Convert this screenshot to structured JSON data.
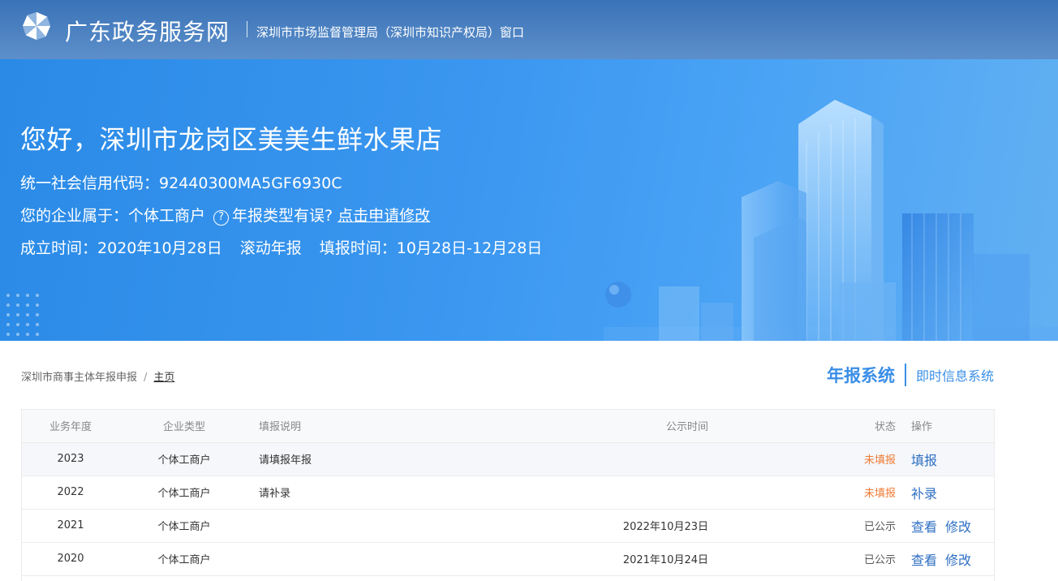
{
  "header": {
    "site_name": "广东政务服务网",
    "window_name": "深圳市市场监督管理局（深圳市知识产权局）窗口",
    "logo_icon": "pinwheel-logo"
  },
  "hero": {
    "greeting": "您好，深圳市龙岗区美美生鲜水果店",
    "credit_code_label": "统一社会信用代码：",
    "credit_code": "92440300MA5GF6930C",
    "category_label": "您的企业属于：",
    "category": "个体工商户",
    "help_icon": "?",
    "help_text": "年报类型有误?",
    "apply_link": "点击申请修改",
    "established_label": "成立时间：",
    "established": "2020年10月28日",
    "report_mode": "滚动年报",
    "fill_period_label": "填报时间：",
    "fill_period": "10月28日-12月28日"
  },
  "breadcrumb": {
    "parent": "深圳市商事主体年报申报",
    "separator": "/",
    "current": "主页"
  },
  "systems": {
    "active": "年报系统",
    "other": "即时信息系统"
  },
  "table": {
    "headers": {
      "year": "业务年度",
      "type": "企业类型",
      "desc": "填报说明",
      "pub": "公示时间",
      "status": "状态",
      "op": "操作"
    },
    "rows": [
      {
        "year": "2023",
        "type": "个体工商户",
        "desc": "请填报年报",
        "pub": "",
        "status": "未填报",
        "op1": "填报",
        "op2": ""
      },
      {
        "year": "2022",
        "type": "个体工商户",
        "desc": "请补录",
        "pub": "",
        "status": "未填报",
        "op1": "补录",
        "op2": ""
      },
      {
        "year": "2021",
        "type": "个体工商户",
        "desc": "",
        "pub": "2022年10月23日",
        "status": "已公示",
        "op1": "查看",
        "op2": "修改"
      },
      {
        "year": "2020",
        "type": "个体工商户",
        "desc": "",
        "pub": "2021年10月24日",
        "status": "已公示",
        "op1": "查看",
        "op2": "修改"
      }
    ]
  },
  "colors": {
    "accent": "#3a8ee6",
    "unfilled": "#f07a32",
    "link": "#2f6fc3"
  }
}
